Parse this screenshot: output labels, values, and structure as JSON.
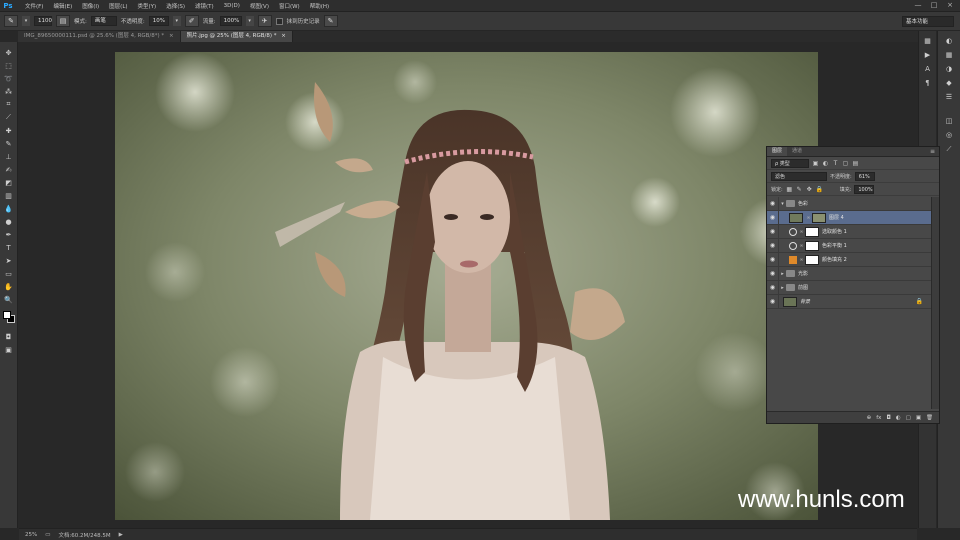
{
  "app": {
    "logo": "Ps"
  },
  "menubar": {
    "items": [
      "文件(F)",
      "编辑(E)",
      "图像(I)",
      "图层(L)",
      "类型(Y)",
      "选择(S)",
      "滤镜(T)",
      "3D(D)",
      "视图(V)",
      "窗口(W)",
      "帮助(H)"
    ],
    "win_min": "—",
    "win_max": "□",
    "win_close": "×"
  },
  "options": {
    "brush_size": "1100",
    "mode_label": "模式:",
    "mode_value": "画笔",
    "opacity_label": "不透明度:",
    "opacity_value": "10%",
    "flow_label": "流量:",
    "flow_value": "100%",
    "history_label": "抹到历史记录",
    "workspace": "基本功能"
  },
  "tabs": [
    {
      "label": "IMG_89650000111.psd @ 25.6% (图层 4, RGB/8*) *",
      "close": "×"
    },
    {
      "label": "照片.jpg @ 25% (图层 4, RGB/8) *",
      "close": "×"
    }
  ],
  "layers_panel": {
    "tab_layers": "图层",
    "tab_channels": "通道",
    "menu": "≡",
    "filter_kind": "ρ 类型",
    "blend_mode": "滤色",
    "opacity_label": "不透明度:",
    "opacity_value": "61%",
    "lock_label": "锁定:",
    "fill_label": "填充:",
    "fill_value": "100%",
    "layers": [
      {
        "name": "色彩",
        "kind": "group-open"
      },
      {
        "name": "图层 4",
        "kind": "pixel"
      },
      {
        "name": "选取颜色 1",
        "kind": "adjust"
      },
      {
        "name": "色彩平衡 1",
        "kind": "adjust"
      },
      {
        "name": "颜色填充 2",
        "kind": "fill"
      },
      {
        "name": "光影",
        "kind": "group"
      },
      {
        "name": "前图",
        "kind": "group"
      },
      {
        "name": "背景",
        "kind": "background"
      }
    ],
    "footer_icons": [
      "⊕",
      "fx",
      "◘",
      "◐",
      "▢",
      "▣",
      "🗑"
    ]
  },
  "status": {
    "zoom": "25%",
    "doc_info": "文档:60.2M/248.5M",
    "nav_arrow": "▶"
  },
  "watermark": "www.hunls.com",
  "colors": {
    "fill_orange": "#e08a2a",
    "selection_blue": "#5a6c8e",
    "ps_blue": "#2aa9ff"
  }
}
